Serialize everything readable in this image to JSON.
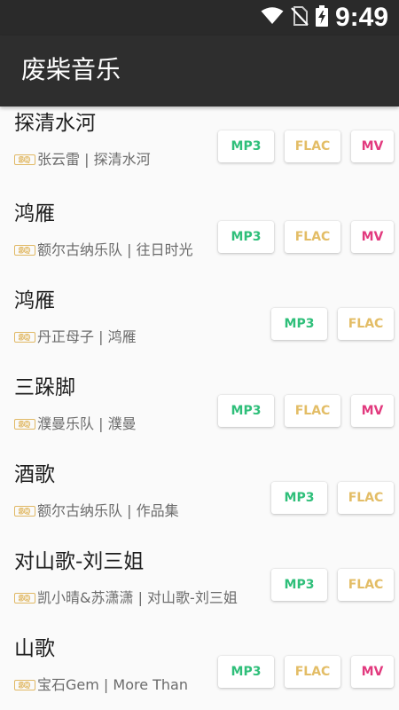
{
  "status_bar": {
    "time": "9:49",
    "icons": [
      "wifi-icon",
      "no-sim-icon",
      "battery-charging-icon"
    ]
  },
  "app_bar": {
    "title": "废柴音乐"
  },
  "songs": [
    {
      "title": "探清水河",
      "subtitle": "张云雷 | 探清水河",
      "badge": "SQ",
      "buttons": [
        "MP3",
        "FLAC",
        "MV"
      ]
    },
    {
      "title": "鸿雁",
      "subtitle": "额尔古纳乐队 | 往日时光",
      "badge": "SQ",
      "buttons": [
        "MP3",
        "FLAC",
        "MV"
      ]
    },
    {
      "title": "鸿雁",
      "subtitle": "丹正母子 | 鸿雁",
      "badge": "SQ",
      "buttons": [
        "MP3",
        "FLAC"
      ]
    },
    {
      "title": "三跺脚",
      "subtitle": "濮曼乐队 | 濮曼",
      "badge": "SQ",
      "buttons": [
        "MP3",
        "FLAC",
        "MV"
      ]
    },
    {
      "title": "酒歌",
      "subtitle": "额尔古纳乐队 | 作品集",
      "badge": "SQ",
      "buttons": [
        "MP3",
        "FLAC"
      ]
    },
    {
      "title": "对山歌-刘三姐",
      "subtitle": "凯小晴&苏潇潇 | 对山歌-刘三姐",
      "badge": "SQ",
      "buttons": [
        "MP3",
        "FLAC"
      ]
    },
    {
      "title": "山歌",
      "subtitle": "宝石Gem | More Than",
      "badge": "SQ",
      "buttons": [
        "MP3",
        "FLAC",
        "MV"
      ]
    }
  ],
  "colors": {
    "status_bar": "#2a2a2a",
    "app_bar": "#2e2e2e",
    "mp3": "#2fbf7a",
    "flac": "#e3bd66",
    "mv": "#e23a7e",
    "sq_badge": "#e0b864"
  }
}
